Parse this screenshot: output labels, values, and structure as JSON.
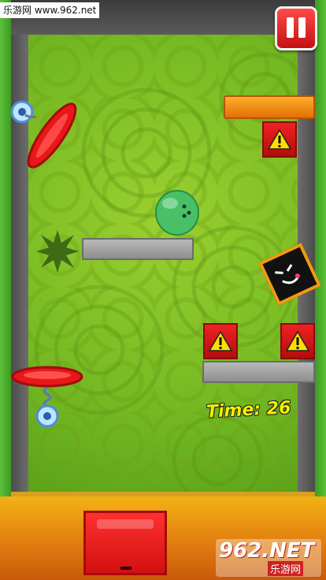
{
  "hud": {
    "timer_text": "Time: 26"
  },
  "watermark": {
    "site_text": "乐游网 www.962.net",
    "logo_main": "962.NET",
    "logo_sub": "乐游网"
  },
  "colors": {
    "playfield_green": "#7cc12a",
    "frame_green": "#4fae2d",
    "pause_red": "#e02020",
    "platform_steel": "#a8a8a8",
    "warning_red": "#d81818",
    "floor_orange": "#f2a214",
    "timer_yellow": "#f4f000"
  },
  "icons": {
    "pause": "pause-icon",
    "warning": "warning-triangle-icon",
    "ball": "bowling-ball-icon"
  }
}
